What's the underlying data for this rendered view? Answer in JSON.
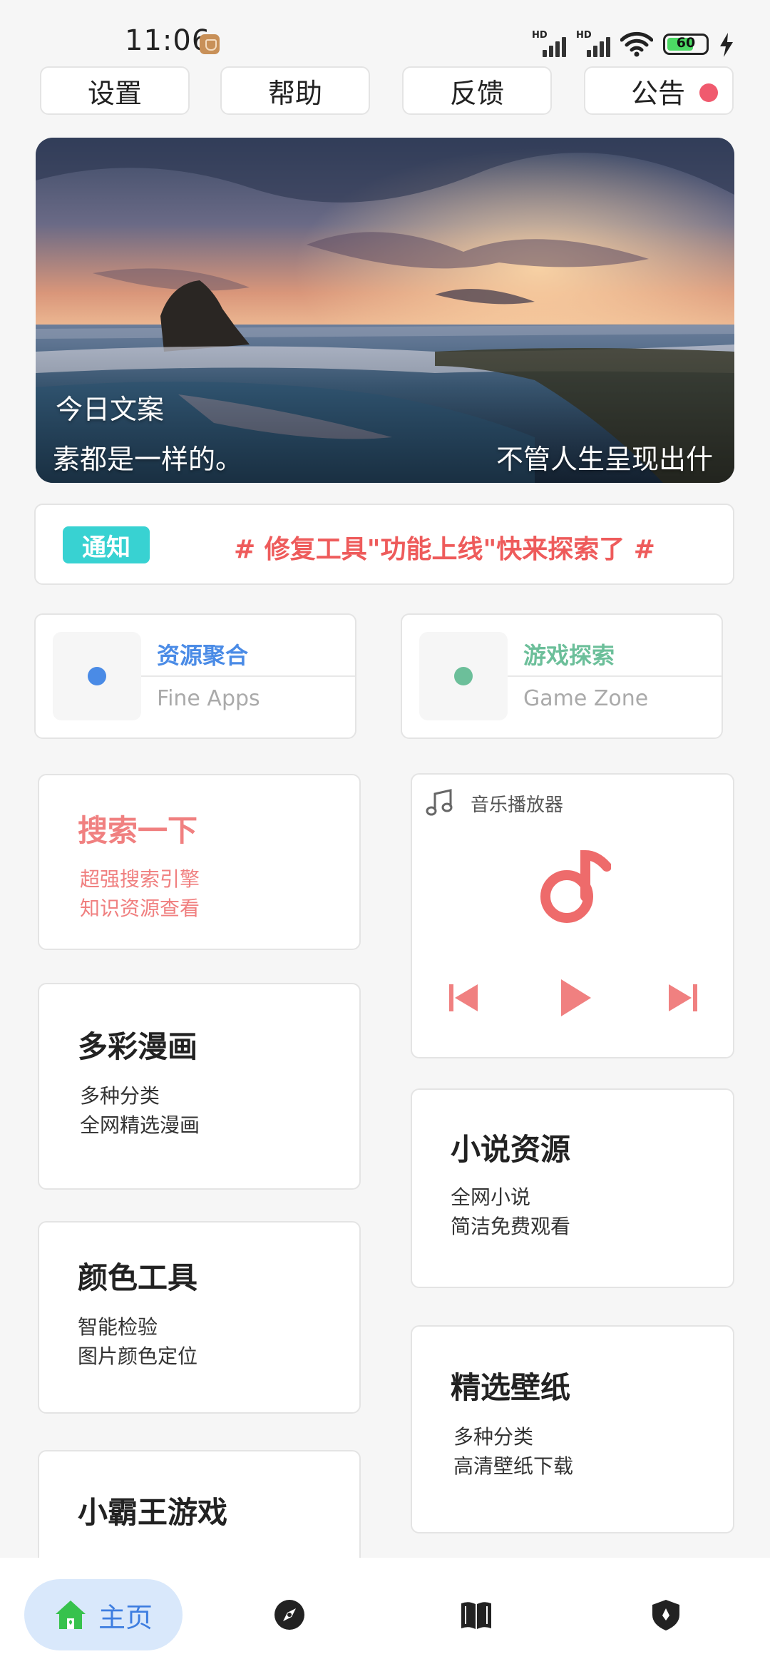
{
  "status_bar": {
    "time": "11:06",
    "network_1": "HD",
    "network_2": "HD",
    "battery_level": "60"
  },
  "top_nav": {
    "settings": "设置",
    "help": "帮助",
    "feedback": "反馈",
    "announcement": "公告"
  },
  "banner": {
    "label": "今日文案",
    "quote_left": "素都是一样的。",
    "quote_right": "不管人生呈现出什"
  },
  "notice": {
    "tag": "通知",
    "text": "# 修复工具\"功能上线\"快来探索了  #"
  },
  "categories": [
    {
      "title": "资源聚合",
      "subtitle": "Fine Apps",
      "color": "#4a8be6"
    },
    {
      "title": "游戏探索",
      "subtitle": "Game Zone",
      "color": "#6cbf9a"
    }
  ],
  "search_card": {
    "title": "搜索一下",
    "line1": "超强搜索引擎",
    "line2": "知识资源查看"
  },
  "music_player": {
    "label": "音乐播放器",
    "accent": "#ee6b6b"
  },
  "comics_card": {
    "title": "多彩漫画",
    "line1": "多种分类",
    "line2": "全网精选漫画"
  },
  "novel_card": {
    "title": "小说资源",
    "line1": "全网小说",
    "line2": "简洁免费观看"
  },
  "color_card": {
    "title": "颜色工具",
    "line1": "智能检验",
    "line2": "图片颜色定位"
  },
  "wallpaper_card": {
    "title": "精选壁纸",
    "line1": "多种分类",
    "line2": "高清壁纸下载"
  },
  "game_card": {
    "title": "小霸王游戏"
  },
  "bottom_nav": {
    "home": "主页",
    "active_color": "#3d7de0"
  }
}
